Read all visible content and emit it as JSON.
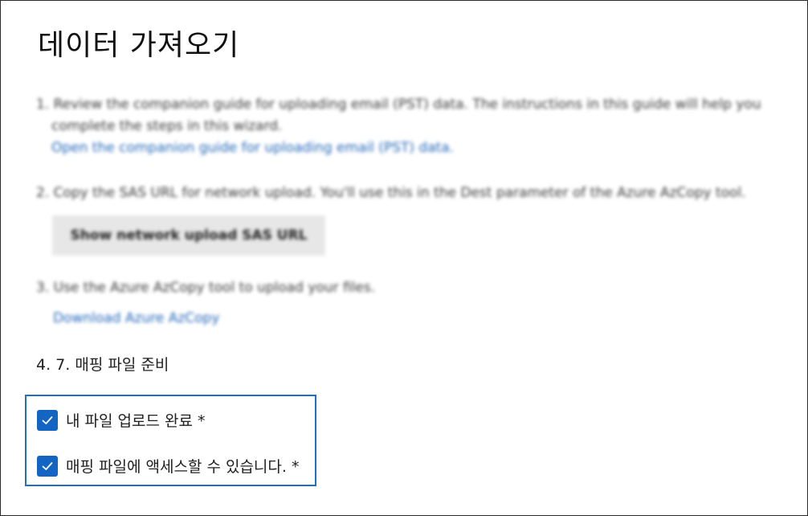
{
  "title": "데이터 가져오기",
  "steps": {
    "s1_line1": "1. Review the companion guide for uploading email (PST) data. The instructions in this guide will help you",
    "s1_line2": "complete the steps in this wizard.",
    "s1_link": "Open the companion guide for uploading email (PST) data.",
    "s2_text": "2. Copy the SAS URL for network upload. You'll use this in the Dest parameter of the Azure AzCopy tool.",
    "s2_button": "Show network upload SAS URL",
    "s3_text": "3. Use the Azure AzCopy tool to upload your files.",
    "s3_link": "Download Azure AzCopy",
    "s4_text": "4. 7. 매핑 파일 준비"
  },
  "checkboxes": [
    {
      "label": "내 파일 업로드 완료 *",
      "checked": true
    },
    {
      "label": "매핑 파일에 액세스할 수 있습니다. *",
      "checked": true
    }
  ],
  "colors": {
    "accent": "#1464c4",
    "link": "#2166b8",
    "border": "#1f6fc7"
  },
  "icons": {
    "checkmark": "checkmark-icon"
  }
}
